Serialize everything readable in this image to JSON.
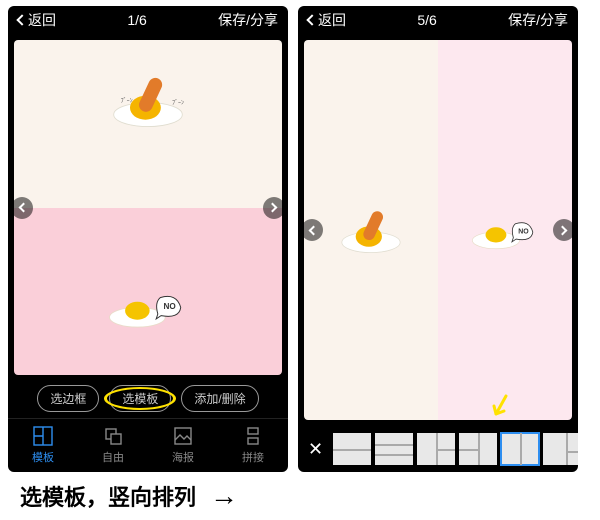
{
  "left": {
    "back": "返回",
    "counter": "1/6",
    "save": "保存/分享",
    "pills": {
      "border": "选边框",
      "template": "选模板",
      "add": "添加/删除"
    },
    "tabs": {
      "template": "模板",
      "free": "自由",
      "poster": "海报",
      "splice": "拼接"
    }
  },
  "right": {
    "back": "返回",
    "counter": "5/6",
    "save": "保存/分享"
  },
  "egg": {
    "no": "NO"
  },
  "caption": "选模板，竖向排列",
  "arrow": "→"
}
